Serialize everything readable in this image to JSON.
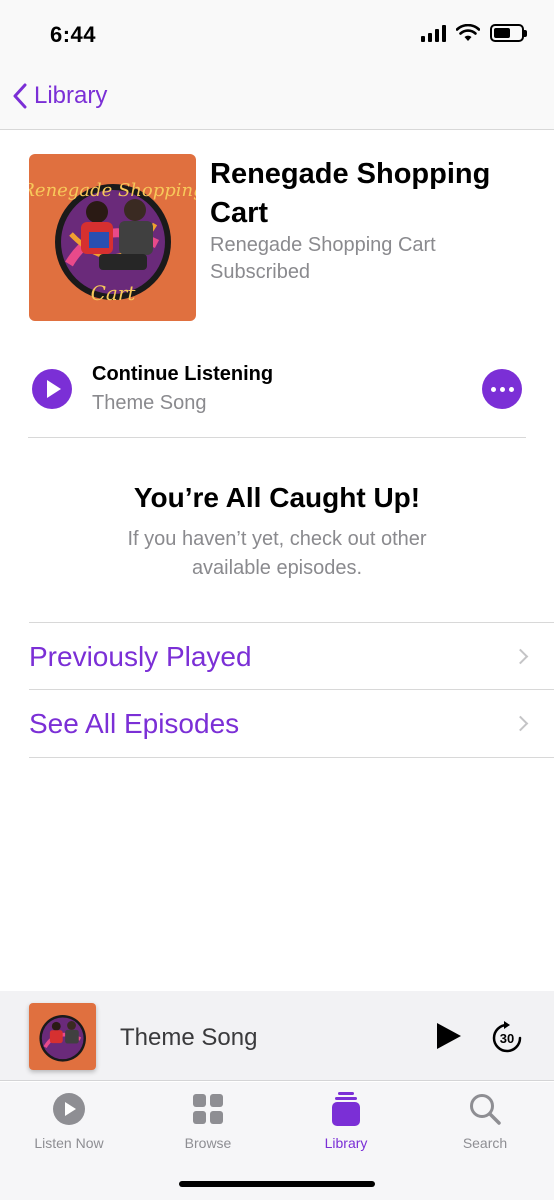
{
  "status_bar": {
    "time": "6:44"
  },
  "nav": {
    "back_label": "Library"
  },
  "podcast": {
    "title": "Renegade Shopping Cart",
    "author": "Renegade Shopping Cart",
    "status": "Subscribed",
    "artwork_text_top": "Renegade Shopping",
    "artwork_text_bottom": "Cart",
    "artwork_bg_color": "#e0703f"
  },
  "continue": {
    "label": "Continue Listening",
    "episode": "Theme Song"
  },
  "caught_up": {
    "title": "You’re All Caught Up!",
    "subtitle": "If you haven’t yet, check out other available episodes."
  },
  "links": [
    {
      "label": "Previously Played"
    },
    {
      "label": "See All Episodes"
    }
  ],
  "mini_player": {
    "title": "Theme Song",
    "skip_label": "30"
  },
  "tabs": [
    {
      "label": "Listen Now",
      "icon": "play-circle-icon",
      "active": false
    },
    {
      "label": "Browse",
      "icon": "grid-icon",
      "active": false
    },
    {
      "label": "Library",
      "icon": "library-stack-icon",
      "active": true
    },
    {
      "label": "Search",
      "icon": "search-icon",
      "active": false
    }
  ],
  "colors": {
    "accent": "#7b2fd6",
    "secondary_text": "#8a8a8e"
  }
}
